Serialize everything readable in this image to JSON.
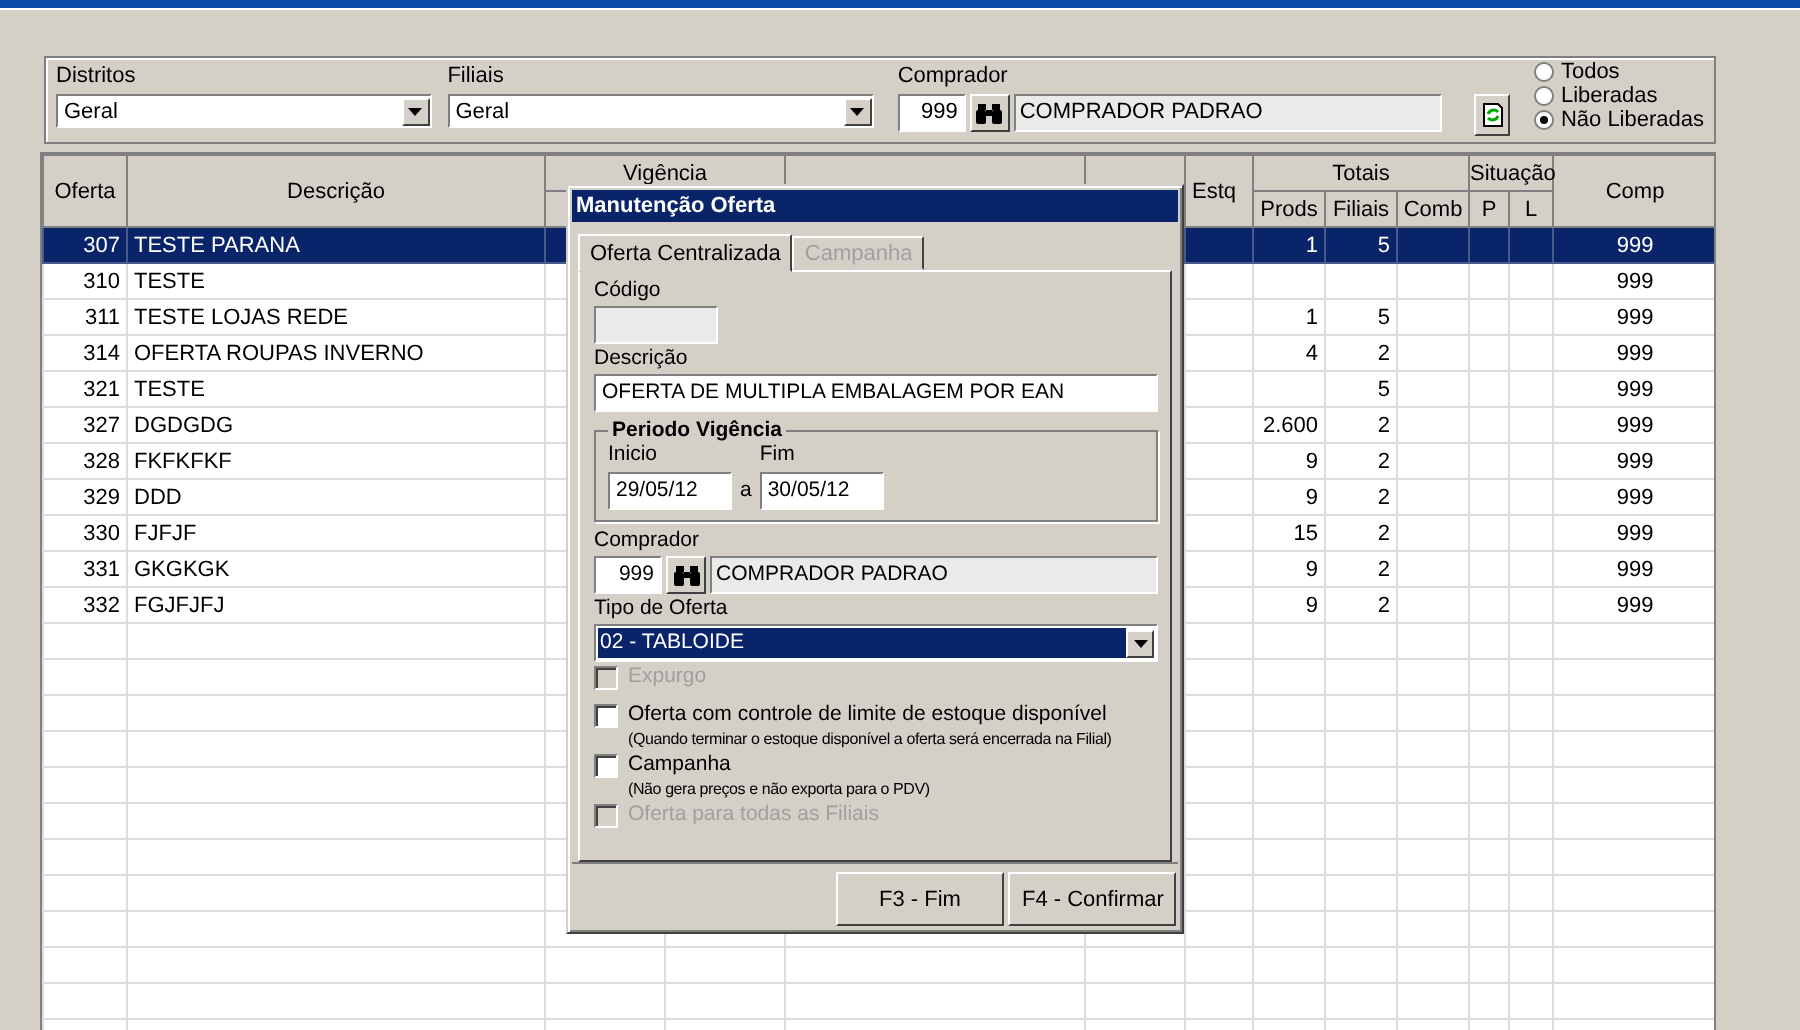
{
  "filters": {
    "distritos": {
      "label": "Distritos",
      "value": "Geral"
    },
    "filiais": {
      "label": "Filiais",
      "value": "Geral"
    },
    "comprador": {
      "label": "Comprador",
      "code": "999",
      "name": "COMPRADOR PADRAO"
    },
    "status_options": [
      {
        "label": "Todos",
        "selected": false
      },
      {
        "label": "Liberadas",
        "selected": false
      },
      {
        "label": "Não Liberadas",
        "selected": true
      }
    ]
  },
  "table": {
    "headers": {
      "oferta": "Oferta",
      "descricao": "Descrição",
      "vigencia": "Vigência",
      "estq": "Estq",
      "totais": "Totais",
      "prods": "Prods",
      "filiais": "Filiais",
      "comb": "Comb",
      "situacao": "Situação",
      "p": "P",
      "l": "L",
      "comp": "Comp"
    },
    "rows": [
      {
        "oferta": "307",
        "descricao": "TESTE PARANA",
        "prods": "1",
        "filiais": "5",
        "comp": "999",
        "selected": true
      },
      {
        "oferta": "310",
        "descricao": "TESTE",
        "comp": "999",
        "selected": false
      },
      {
        "oferta": "311",
        "descricao": "TESTE LOJAS REDE",
        "prods": "1",
        "filiais": "5",
        "comp": "999",
        "selected": false
      },
      {
        "oferta": "314",
        "descricao": "OFERTA ROUPAS INVERNO",
        "prods": "4",
        "filiais": "2",
        "comp": "999",
        "selected": false
      },
      {
        "oferta": "321",
        "descricao": "TESTE",
        "filiais": "5",
        "comp": "999",
        "selected": false
      },
      {
        "oferta": "327",
        "descricao": "DGDGDG",
        "prods": "2.600",
        "filiais": "2",
        "comp": "999",
        "selected": false
      },
      {
        "oferta": "328",
        "descricao": "FKFKFKF",
        "prods": "9",
        "filiais": "2",
        "comp": "999",
        "selected": false
      },
      {
        "oferta": "329",
        "descricao": "DDD",
        "prods": "9",
        "filiais": "2",
        "comp": "999",
        "selected": false
      },
      {
        "oferta": "330",
        "descricao": "FJFJF",
        "prods": "15",
        "filiais": "2",
        "comp": "999",
        "selected": false
      },
      {
        "oferta": "331",
        "descricao": "GKGKGK",
        "prods": "9",
        "filiais": "2",
        "comp": "999",
        "selected": false
      },
      {
        "oferta": "332",
        "descricao": "FGJFJFJ",
        "prods": "9",
        "filiais": "2",
        "comp": "999",
        "selected": false
      }
    ]
  },
  "dialog": {
    "title": "Manutenção Oferta",
    "tabs": [
      {
        "label": "Oferta Centralizada",
        "selected": true,
        "disabled": false
      },
      {
        "label": "Campanha",
        "selected": false,
        "disabled": true
      }
    ],
    "codigo": {
      "label": "Código"
    },
    "descricao": {
      "label": "Descrição",
      "value": "OFERTA DE MULTIPLA EMBALAGEM POR EAN"
    },
    "periodo": {
      "title": "Periodo Vigência",
      "inicio_label": "Inicio",
      "inicio": "29/05/12",
      "separator": "a",
      "fim_label": "Fim",
      "fim": "30/05/12"
    },
    "comprador": {
      "label": "Comprador",
      "code": "999",
      "name": "COMPRADOR PADRAO"
    },
    "tipo": {
      "label": "Tipo de Oferta",
      "value": "02 - TABLOIDE"
    },
    "checkboxes": [
      {
        "label": "Expurgo",
        "checked": false,
        "disabled": true
      },
      {
        "label": "Oferta com controle de limite de estoque disponível",
        "note": "(Quando terminar o estoque disponível a oferta será encerrada na Filial)",
        "checked": false,
        "disabled": false
      },
      {
        "label": "Campanha",
        "note": "(Não gera preços e não exporta para o PDV)",
        "checked": false,
        "disabled": false
      },
      {
        "label": "Oferta para todas as Filiais",
        "checked": false,
        "disabled": true
      }
    ],
    "buttons": [
      "F3 - Fim",
      "F4 - Confirmar"
    ]
  }
}
